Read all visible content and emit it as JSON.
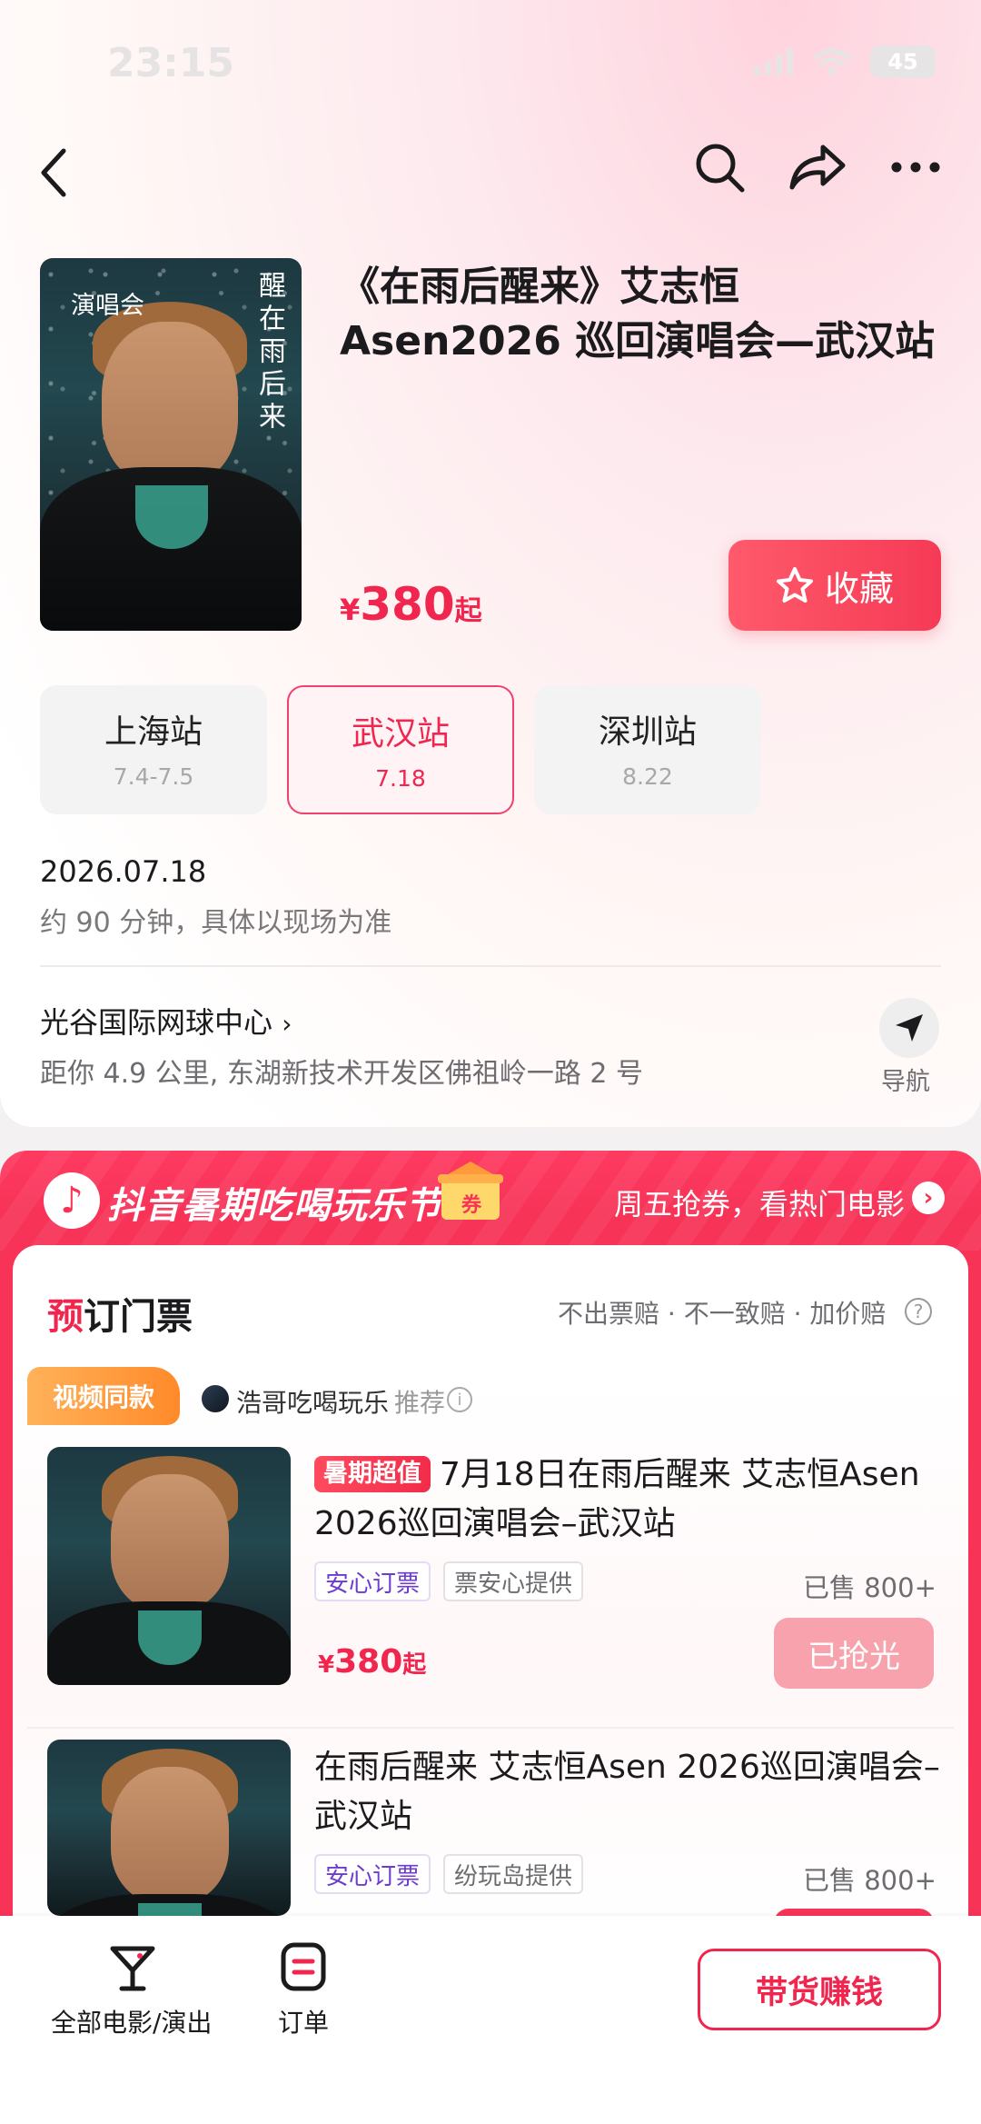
{
  "status": {
    "time": "23:15",
    "battery": "45"
  },
  "nav": {
    "back": "back",
    "search": "search",
    "share": "share",
    "more": "more"
  },
  "event": {
    "poster_tag": "演唱会",
    "poster_title": "醒在雨后来",
    "title": "《在雨后醒来》艾志恒 Asen2026 巡回演唱会—武汉站",
    "price_currency": "¥",
    "price_value": "380",
    "price_suffix": "起",
    "favorite_label": "收藏"
  },
  "cities": [
    {
      "name": "上海站",
      "date": "7.4-7.5",
      "active": false
    },
    {
      "name": "武汉站",
      "date": "7.18",
      "active": true
    },
    {
      "name": "深圳站",
      "date": "8.22",
      "active": false
    }
  ],
  "schedule": {
    "date": "2026.07.18",
    "duration": "约 90 分钟，具体以现场为准"
  },
  "venue": {
    "name": "光谷国际网球中心",
    "address": "距你 4.9 公里, 东湖新技术开发区佛祖岭一路 2 号",
    "nav_label": "导航"
  },
  "festival": {
    "title": "抖音暑期吃喝玩乐节",
    "coupon": "券",
    "right_text": "周五抢券，看热门电影"
  },
  "tickets": {
    "heading_first": "预",
    "heading_rest": "订门票",
    "guarantee": "不出票赔 · 不一致赔 · 加价赔",
    "video_badge": "视频同款",
    "recommender": "浩哥吃喝玩乐",
    "recommend_tag": "推荐",
    "items": [
      {
        "badge": "暑期超值",
        "title": "7月18日在雨后醒来 艾志恒Asen 2026巡回演唱会–武汉站",
        "chip_safe": "安心订票",
        "chip_provider": "票安心提供",
        "sold": "已售 800+",
        "price_currency": "¥",
        "price_value": "380",
        "price_suffix": "起",
        "button": "已抢光"
      },
      {
        "title": "在雨后醒来 艾志恒Asen 2026巡回演唱会–武汉站",
        "chip_safe": "安心订票",
        "chip_provider": "纷玩岛提供",
        "sold": "已售 800+"
      }
    ]
  },
  "bottom": {
    "movies_label": "全部电影/演出",
    "orders_label": "订单",
    "earn_label": "带货赚钱"
  },
  "colors": {
    "accent": "#f0264f",
    "festival": "#f73358",
    "badge_orange": "#ff8a2a"
  }
}
